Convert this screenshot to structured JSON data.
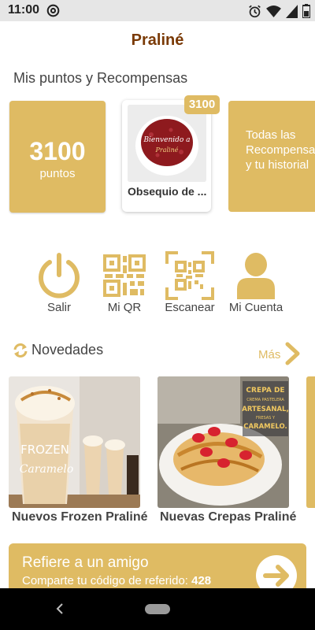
{
  "status_bar": {
    "time": "11:00",
    "left_icons": [
      "at-sign-icon"
    ],
    "right_icons": [
      "alarm-icon",
      "wifi-icon",
      "signal-icon",
      "battery-icon"
    ]
  },
  "app": {
    "title": "Praliné"
  },
  "rewards_section": {
    "title": "Mis puntos y Recompensas",
    "points_value": "3100",
    "points_unit": "puntos",
    "featured_reward": {
      "name": "Obsequio de ...",
      "cost_badge": "3100",
      "image_text_1": "Bienvenido a",
      "image_text_2": "Praliné"
    },
    "all_rewards_label": "Todas las Recompensas y tu historial"
  },
  "actions": [
    {
      "label": "Salir",
      "icon": "power-icon"
    },
    {
      "label": "Mi QR",
      "icon": "qr-code-icon"
    },
    {
      "label": "Escanear",
      "icon": "scan-qr-icon"
    },
    {
      "label": "Mi Cuenta",
      "icon": "user-icon"
    }
  ],
  "news_section": {
    "title": "Novedades",
    "more_label": "Más",
    "items": [
      {
        "caption": "Nuevos Frozen Praliné",
        "image_text_1": "FROZEN",
        "image_text_2": "Caramelo"
      },
      {
        "caption": "Nuevas Crepas Praliné",
        "image_text_1": "CREPA DE",
        "image_text_2": "CREMA PASTELERA",
        "image_text_3": "ARTESANAL,",
        "image_text_4": "FRESAS Y",
        "image_text_5": "CARAMELO."
      }
    ]
  },
  "referral": {
    "title": "Refiere a un amigo",
    "subtitle": "Comparte tu código de referido:",
    "code": "428"
  },
  "colors": {
    "accent": "#dfbb63",
    "title": "#7a3a06"
  }
}
